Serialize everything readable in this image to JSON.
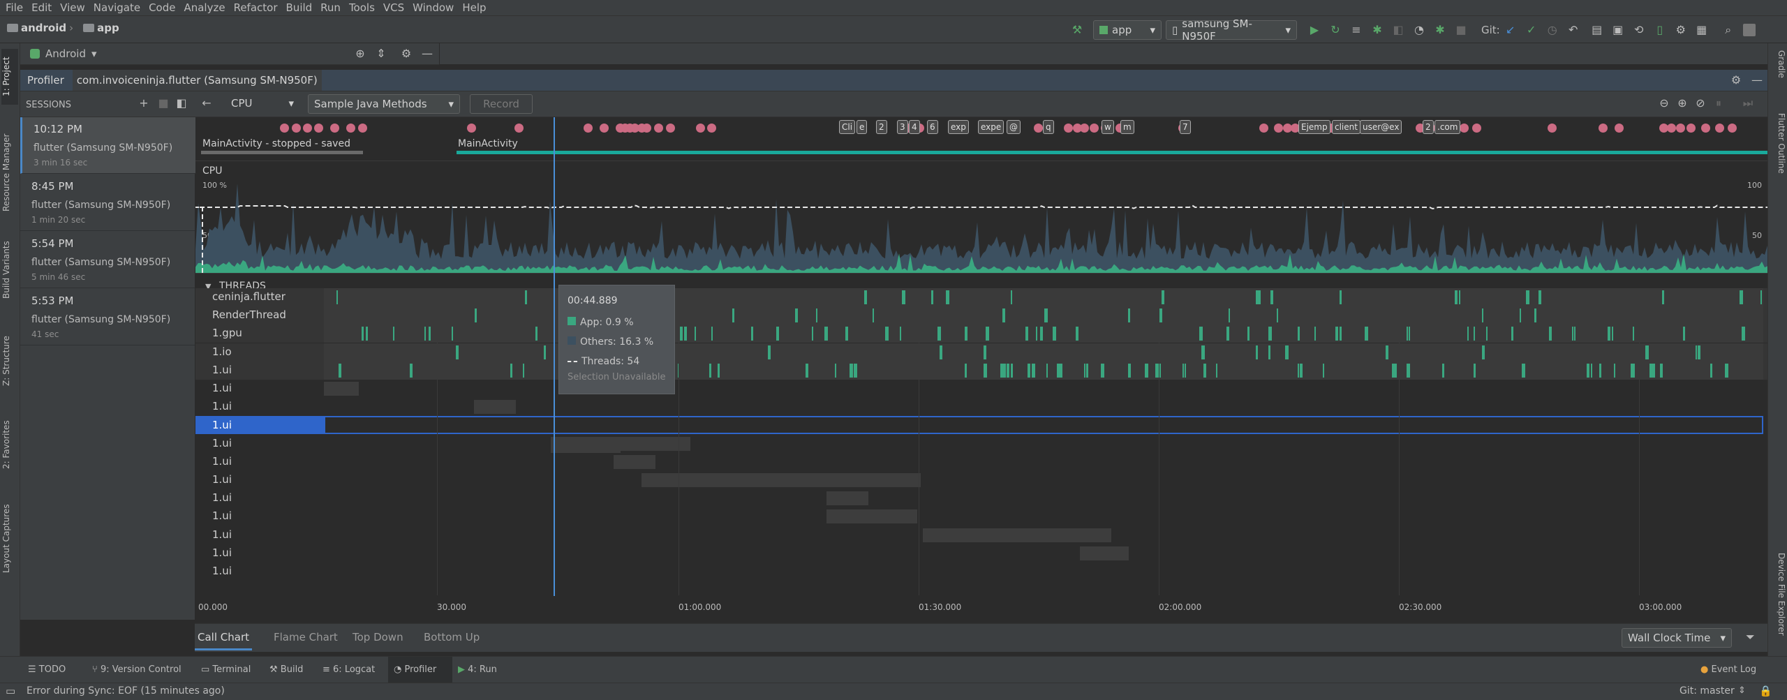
{
  "menu": [
    "File",
    "Edit",
    "View",
    "Navigate",
    "Code",
    "Analyze",
    "Refactor",
    "Build",
    "Run",
    "Tools",
    "VCS",
    "Window",
    "Help"
  ],
  "breadcrumb": {
    "root": "android",
    "module": "app"
  },
  "toolbar": {
    "run_config": "app",
    "device": "samsung SM-N950F",
    "git_label": "Git:"
  },
  "project_panel": {
    "view_mode": "Android"
  },
  "profiler": {
    "tab_label": "Profiler",
    "process": "com.invoiceninja.flutter (Samsung SM-N950F)",
    "monitor": "CPU",
    "config": "Sample Java Methods",
    "record_label": "Record",
    "sessions_label": "SESSIONS"
  },
  "sessions": [
    {
      "time": "10:12 PM",
      "device": "flutter (Samsung SM-N950F)",
      "length": "3 min 16 sec"
    },
    {
      "time": "8:45 PM",
      "device": "flutter (Samsung SM-N950F)",
      "length": "1 min 20 sec"
    },
    {
      "time": "5:54 PM",
      "device": "flutter (Samsung SM-N950F)",
      "length": "5 min 46 sec"
    },
    {
      "time": "5:53 PM",
      "device": "flutter (Samsung SM-N950F)",
      "length": "41 sec"
    }
  ],
  "lifecycle": {
    "first": "MainActivity - stopped - saved",
    "second": "MainActivity"
  },
  "event_tags": [
    "Cli",
    "e",
    "2",
    "3",
    "4",
    "6",
    "exp",
    "expe",
    "@",
    "q",
    "w",
    "m",
    "7",
    "Ejemp",
    "client",
    "user@ex",
    "2",
    ".com"
  ],
  "cpu": {
    "label": "CPU",
    "max_left": "100 %",
    "mid_left": "50",
    "max_right": "100",
    "mid_right": "50"
  },
  "threads_header": "THREADS",
  "threads": [
    "ceninja.flutter",
    "RenderThread",
    "1.gpu",
    "1.io",
    "1.ui",
    "1.ui",
    "1.ui",
    "1.ui",
    "1.ui",
    "1.ui",
    "1.ui",
    "1.ui",
    "1.ui",
    "1.ui",
    "1.ui",
    "1.ui"
  ],
  "selected_thread_index": 7,
  "axis_ticks": [
    "00.000",
    "30.000",
    "01:00.000",
    "01:30.000",
    "02:00.000",
    "02:30.000",
    "03:00.000"
  ],
  "tooltip": {
    "time": "00:44.889",
    "app": "App: 0.9 %",
    "others": "Others: 16.3 %",
    "threads": "Threads: 54",
    "selection": "Selection Unavailable"
  },
  "analysis_tabs": [
    "Call Chart",
    "Flame Chart",
    "Top Down",
    "Bottom Up"
  ],
  "clock": "Wall Clock Time",
  "tool_windows": [
    "TODO",
    "9: Version Control",
    "Terminal",
    "Build",
    "6: Logcat",
    "Profiler",
    "4: Run"
  ],
  "event_log": "Event Log",
  "status": {
    "message": "Error during Sync: EOF (15 minutes ago)",
    "branch": "Git: master"
  },
  "left_strip": [
    "1: Project",
    "Resource Manager",
    "Build Variants",
    "Z: Structure",
    "2: Favorites",
    "Layout Captures"
  ],
  "right_strip": [
    "Gradle",
    "Flutter Outline",
    "Device File Explorer"
  ],
  "colors": {
    "app": "#3aa780",
    "others": "#3c5060",
    "event": "#cc6b83",
    "selection": "#2f65ca",
    "lifecycle": "#1aa99b"
  }
}
